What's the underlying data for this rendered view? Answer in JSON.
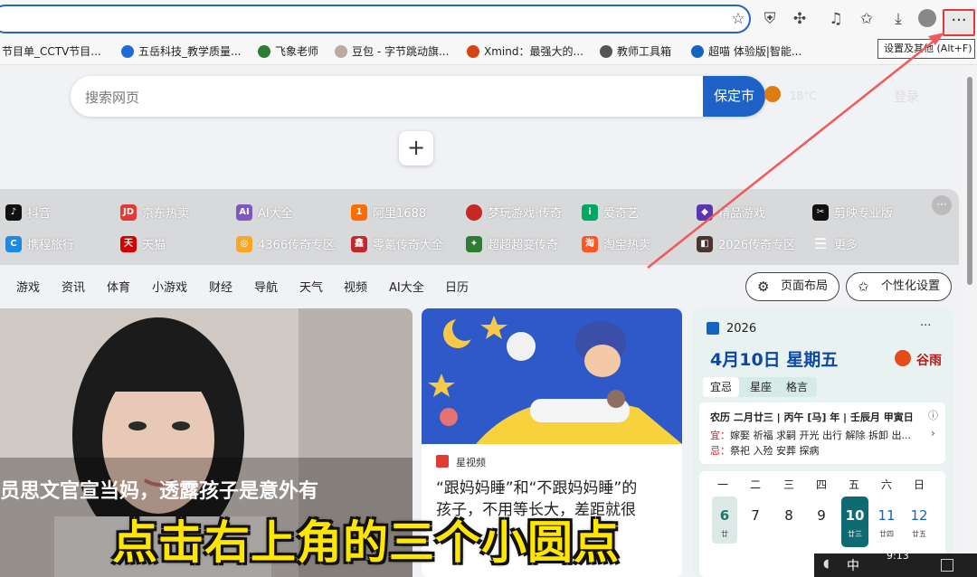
{
  "browser": {
    "tooltip": "设置及其他 (Alt+F)",
    "menu_button": "···",
    "accent": "#e53935"
  },
  "bookmarks": [
    "节目单_CCTV节目...",
    "五岳科技_教学质量...",
    "飞象老师",
    "豆包 - 字节跳动旗...",
    "Xmind：最强大的...",
    "教师工具箱",
    "超喵 体验版|智能..."
  ],
  "search": {
    "placeholder": "搜索网页",
    "button": "保定市",
    "weather": "18°C",
    "login": "登录"
  },
  "quicklinks": {
    "row1": [
      "抖音",
      "京东热卖",
      "AI大全",
      "阿里1688",
      "梦玩游戏·传奇",
      "爱奇艺",
      "精品游戏",
      "剪映专业版"
    ],
    "row2": [
      "携程旅行",
      "天猫",
      "4366传奇专区",
      "零氪传奇大全",
      "超超超变传奇",
      "淘宝热卖",
      "2026传奇专区",
      "更多"
    ],
    "more": "···"
  },
  "nav": {
    "items": [
      "游戏",
      "资讯",
      "体育",
      "小游戏",
      "财经",
      "导航",
      "天气",
      "视频",
      "AI大全",
      "日历"
    ],
    "layout_btn": "页面布局",
    "personalize_btn": "个性化设置"
  },
  "news": {
    "main_title": "员思文官宣当妈，透露孩子是意外有",
    "card2_source": "星视频",
    "card2_title_line1": "“跟妈妈睡”和“不跟妈妈睡”的",
    "card2_title_line2": "孩子，不用等长大，差距就很"
  },
  "calendar": {
    "year": "2026",
    "date": "4月10日 星期五",
    "solar_term": "谷雨",
    "tabs": [
      "宜忌",
      "星座",
      "格言"
    ],
    "lunar": "农历 二月廿三 | 丙午 [马] 年 | 壬辰月 甲寅日",
    "yi_label": "宜：",
    "yi": "嫁娶 祈福 求嗣 开光 出行 解除 拆卸 出...",
    "ji_label": "忌：",
    "ji": "祭祀 入殓 安葬 探病",
    "weekdays": [
      "一",
      "二",
      "三",
      "四",
      "五",
      "六",
      "日"
    ],
    "days": [
      "6",
      "7",
      "8",
      "9",
      "10",
      "11",
      "12"
    ],
    "subs": [
      "廿",
      "",
      "",
      "",
      "廿三",
      "廿四",
      "廿五"
    ],
    "more": "···"
  },
  "overlay": "点击右上角的三个小圆点",
  "taskbar": {
    "time": "9:13",
    "ime": "中"
  }
}
